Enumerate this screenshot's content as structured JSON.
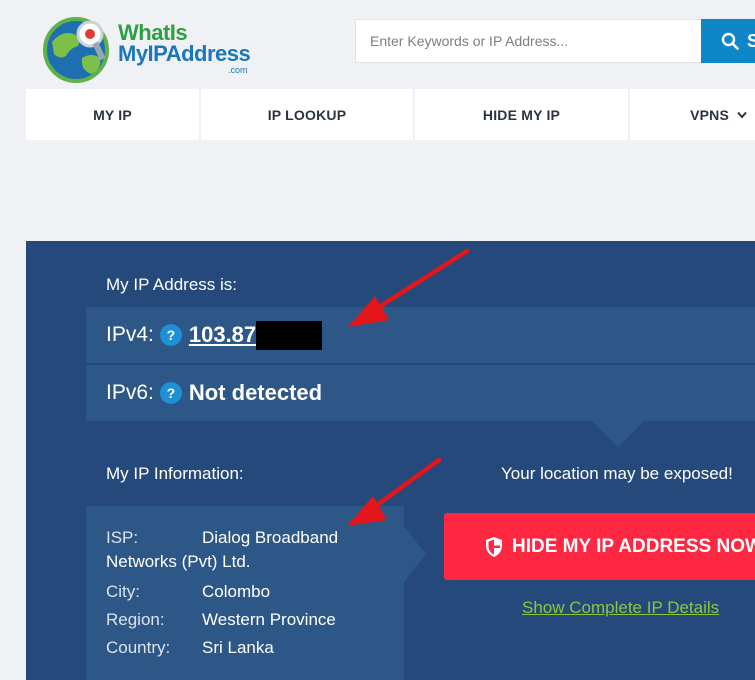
{
  "logo": {
    "line1": "WhatIs",
    "line2": "MyIPAddress",
    "suffix": ".com"
  },
  "search": {
    "placeholder": "Enter Keywords or IP Address...",
    "button_label": "S"
  },
  "nav": {
    "items": [
      {
        "label": "MY IP"
      },
      {
        "label": "IP LOOKUP"
      },
      {
        "label": "HIDE MY IP"
      },
      {
        "label": "VPNS"
      }
    ]
  },
  "ip": {
    "heading": "My IP Address is:",
    "ipv4_label": "IPv4:",
    "ipv4_value": "103.87",
    "ipv6_label": "IPv6:",
    "ipv6_value": "Not detected",
    "help_glyph": "?"
  },
  "info": {
    "heading": "My IP Information:",
    "isp_label": "ISP:",
    "isp_line1": "Dialog Broadband",
    "isp_line2": "Networks (Pvt) Ltd.",
    "city_label": "City:",
    "city_value": "Colombo",
    "region_label": "Region:",
    "region_value": "Western Province",
    "country_label": "Country:",
    "country_value": "Sri Lanka"
  },
  "cta": {
    "warning": "Your location may be exposed!",
    "hide_button": "HIDE MY IP ADDRESS NOW",
    "details_link": "Show Complete IP Details"
  },
  "colors": {
    "panel": "#24497a",
    "row": "#2d5787",
    "accent_blue": "#0f86c7",
    "cta_red": "#ff2741",
    "link_green": "#8cc63f",
    "annotation_red": "#e3161b"
  }
}
